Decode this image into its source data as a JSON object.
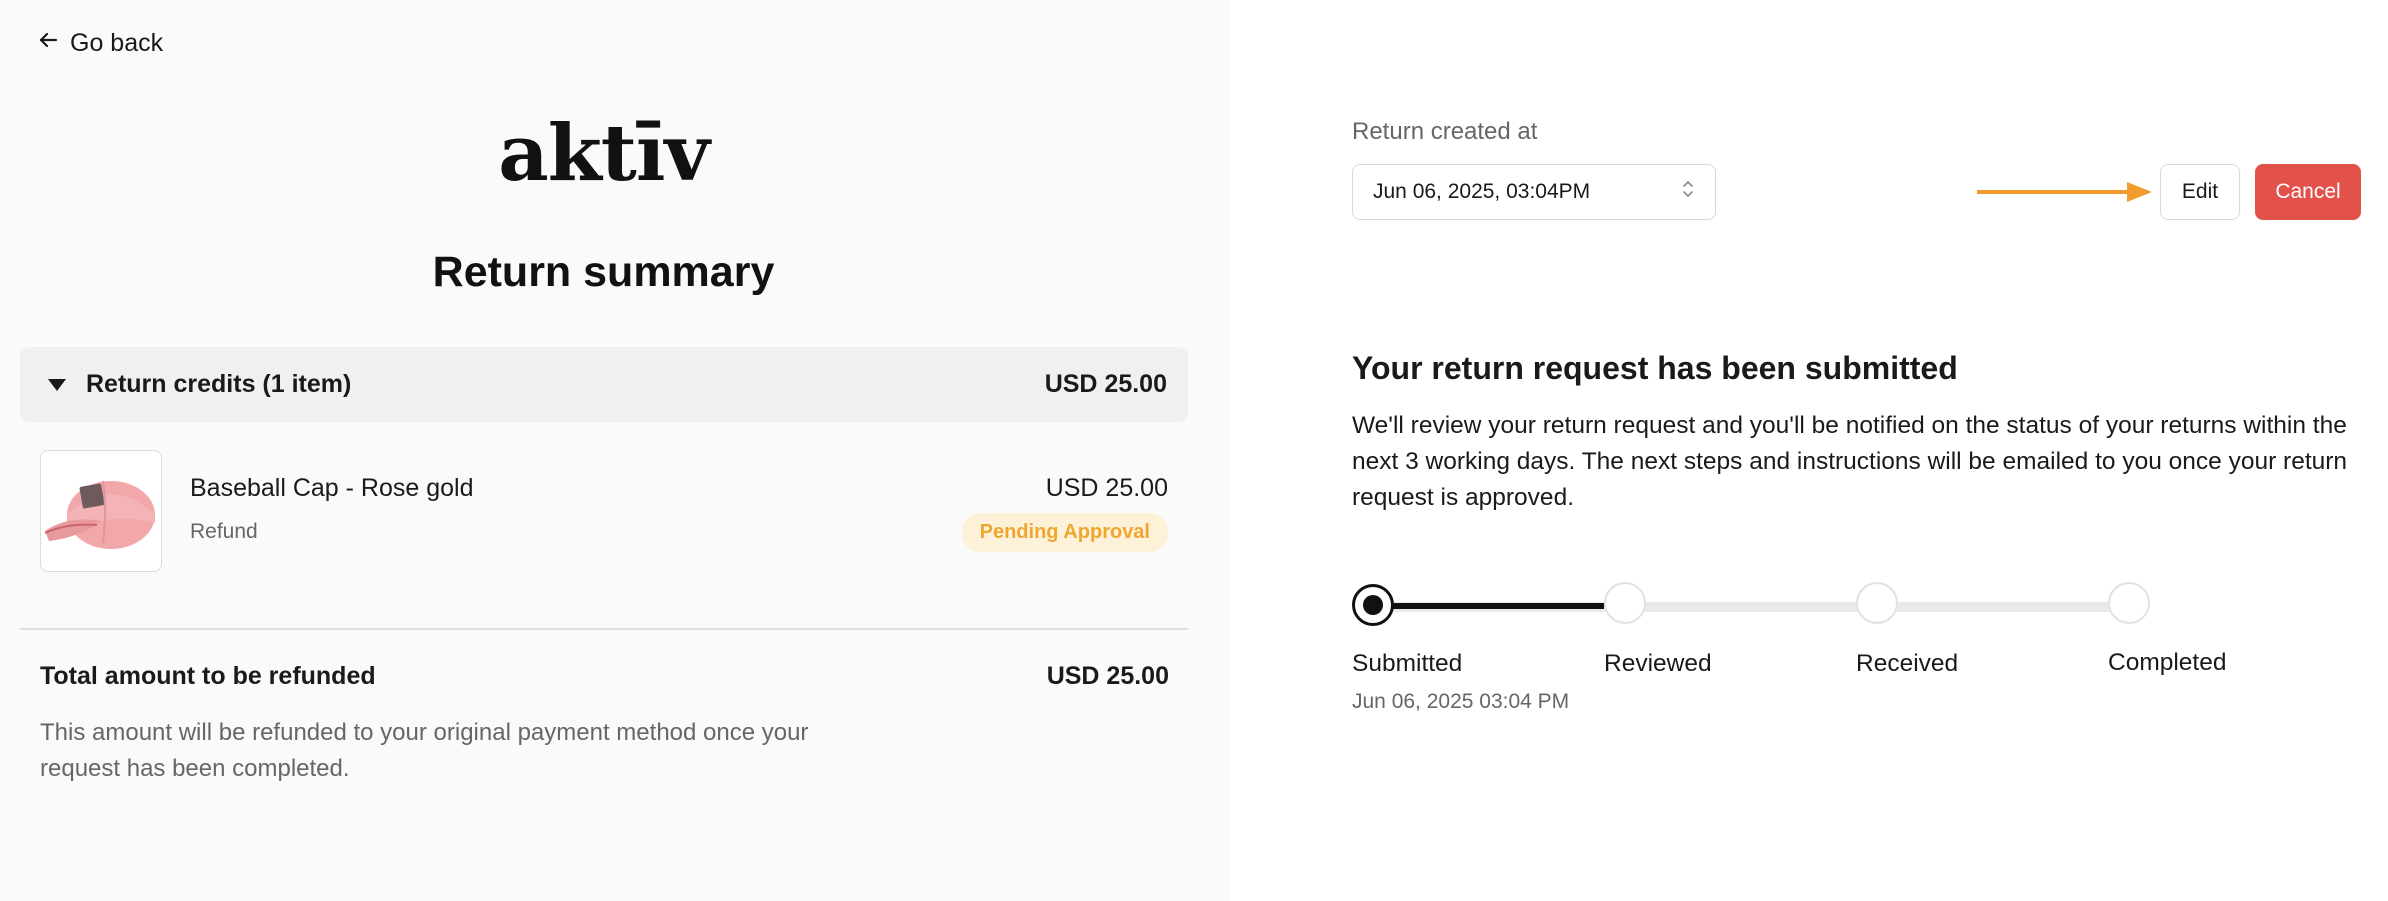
{
  "nav": {
    "go_back_label": "Go back"
  },
  "brand": {
    "logo_text": "aktīv"
  },
  "summary": {
    "title": "Return summary",
    "credits_label": "Return credits (1 item)",
    "credits_total": "USD 25.00",
    "items": [
      {
        "name": "Baseball Cap - Rose gold",
        "type": "Refund",
        "price": "USD 25.00",
        "status": "Pending Approval",
        "thumbnail_icon": "pink-baseball-cap-image"
      }
    ],
    "total_label": "Total amount to be refunded",
    "total_amount": "USD 25.00",
    "total_note": "This amount will be refunded to your original payment method once your request has been completed."
  },
  "return_info": {
    "created_label": "Return created at",
    "created_value": "Jun 06, 2025, 03:04PM",
    "edit_label": "Edit",
    "cancel_label": "Cancel"
  },
  "status": {
    "heading": "Your return request has been submitted",
    "description": "We'll review your return request and you'll be notified on the status of your returns within the next 3 working days. The next steps and instructions will be emailed to you once your return request is approved.",
    "steps": [
      {
        "label": "Submitted",
        "date": "Jun 06, 2025 03:04 PM",
        "done": true
      },
      {
        "label": "Reviewed",
        "date": "",
        "done": false
      },
      {
        "label": "Received",
        "date": "",
        "done": false
      },
      {
        "label": "Completed",
        "date": "",
        "done": false
      }
    ]
  },
  "colors": {
    "accent_red": "#e2524b",
    "badge_text": "#eea630",
    "badge_bg": "#fdf2d7",
    "annotation_arrow": "#f29b2f",
    "left_panel_bg": "#fafafa"
  }
}
